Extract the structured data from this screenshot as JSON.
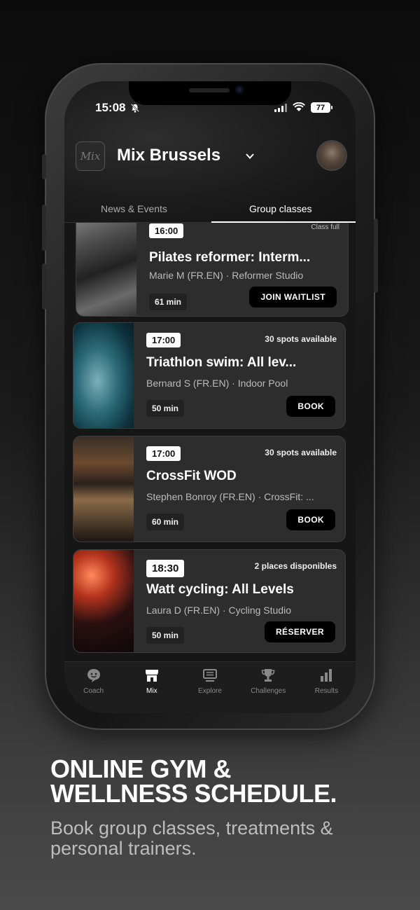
{
  "status_bar": {
    "time": "15:08",
    "battery": "77"
  },
  "header": {
    "logo_text": "Mix",
    "gym_name": "Mix Brussels"
  },
  "tabs": [
    {
      "label": "News & Events",
      "active": false
    },
    {
      "label": "Group classes",
      "active": true
    }
  ],
  "classes": [
    {
      "time": "16:00",
      "availability": "Class full",
      "title": "Pilates reformer: Interm...",
      "coach": "Marie M (FR.EN)",
      "location": "Reformer Studio",
      "duration": "61 min",
      "action": "JOIN WAITLIST"
    },
    {
      "time": "17:00",
      "availability": "30 spots available",
      "title": "Triathlon swim: All lev...",
      "coach": "Bernard S (FR.EN)",
      "location": "Indoor Pool",
      "duration": "50 min",
      "action": "BOOK"
    },
    {
      "time": "17:00",
      "availability": "30 spots available",
      "title": "CrossFit WOD",
      "coach": "Stephen Bonroy (FR.EN)",
      "location": "CrossFit: ...",
      "duration": "60 min",
      "action": "BOOK"
    },
    {
      "time": "18:30",
      "availability": "2 places disponibles",
      "title": "Watt cycling: All Levels",
      "coach": "Laura D (FR.EN)",
      "location": "Cycling Studio",
      "duration": "50 min",
      "action": "RÉSERVER"
    }
  ],
  "nav": [
    {
      "label": "Coach",
      "icon": "chat-face-icon",
      "active": false
    },
    {
      "label": "Mix",
      "icon": "store-icon",
      "active": true
    },
    {
      "label": "Explore",
      "icon": "monitor-icon",
      "active": false
    },
    {
      "label": "Challenges",
      "icon": "trophy-icon",
      "active": false
    },
    {
      "label": "Results",
      "icon": "bar-chart-icon",
      "active": false
    }
  ],
  "marketing": {
    "headline_line1": "ONLINE GYM &",
    "headline_line2": "WELLNESS SCHEDULE.",
    "subline": "Book group classes, treatments & personal trainers."
  }
}
